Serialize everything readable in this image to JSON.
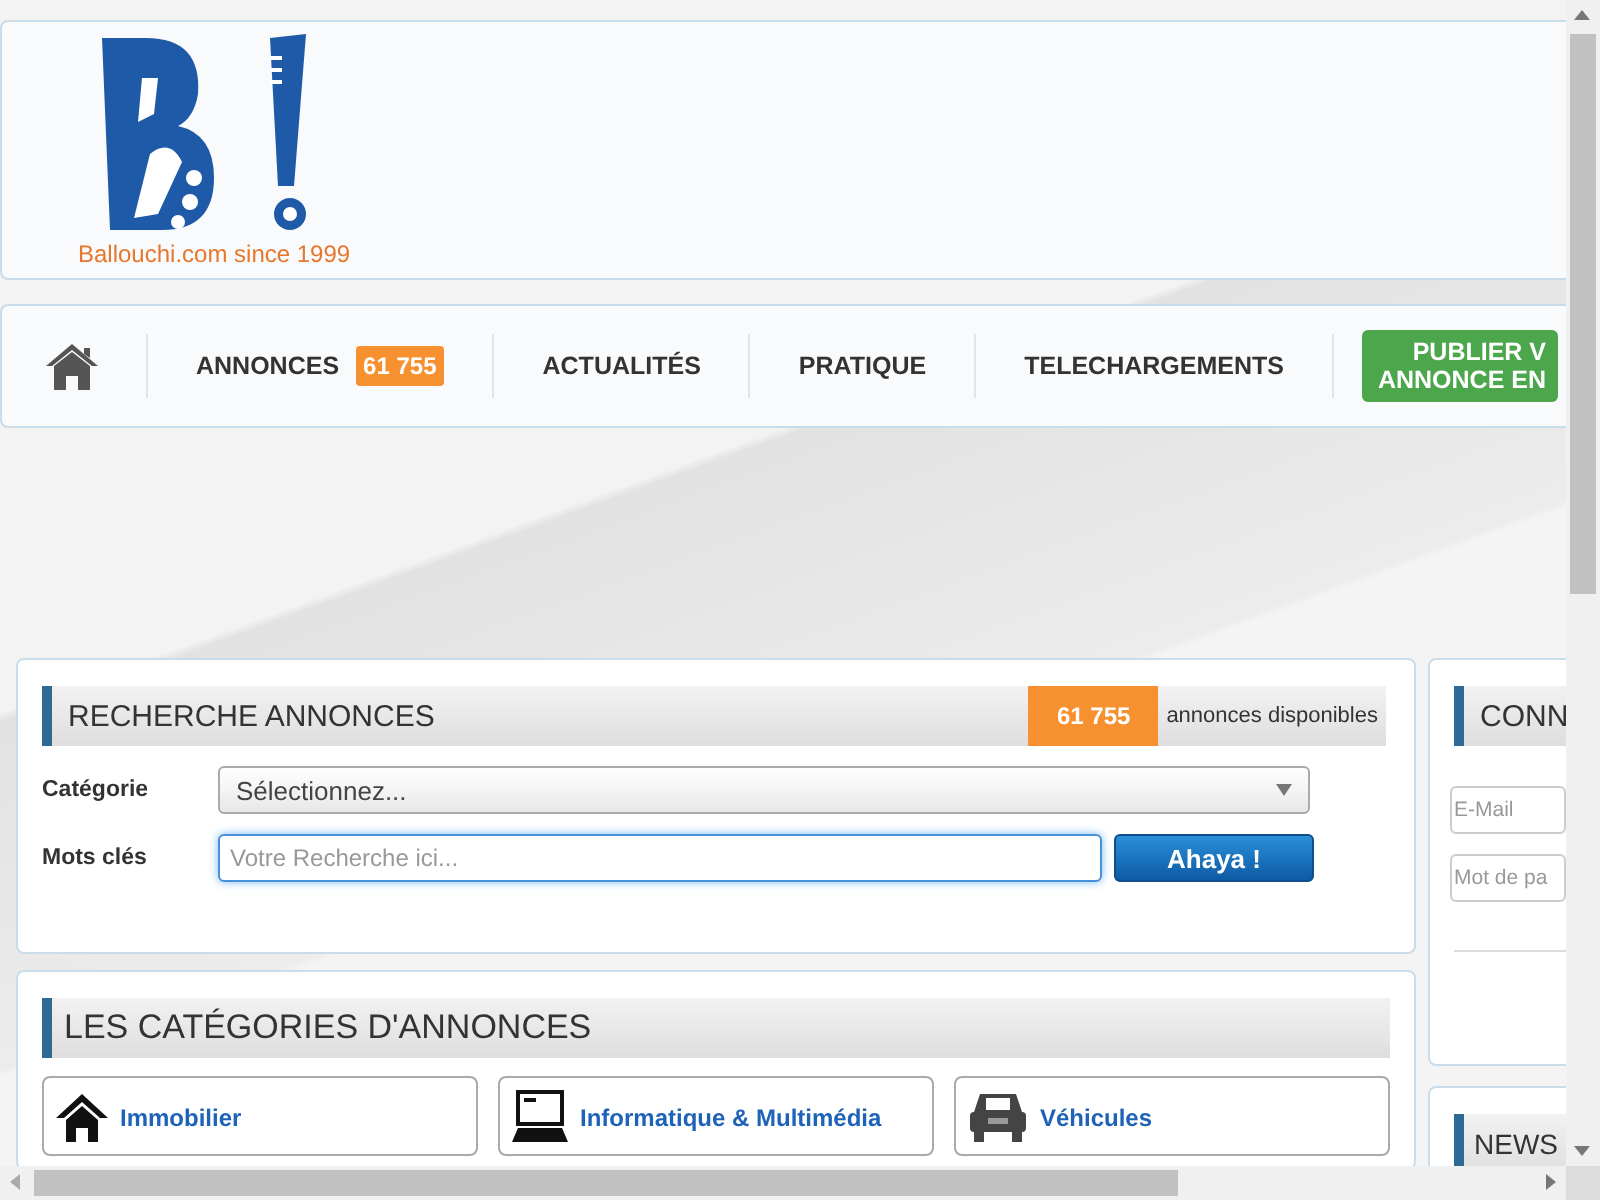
{
  "header": {
    "slogan": "Ballouchi.com since 1999"
  },
  "nav": {
    "items": [
      {
        "label": "ANNONCES",
        "badge": "61 755"
      },
      {
        "label": "ACTUALITÉS"
      },
      {
        "label": "PRATIQUE"
      },
      {
        "label": "TELECHARGEMENTS"
      }
    ],
    "publish_button": [
      "PUBLIER V",
      "ANNONCE EN"
    ]
  },
  "search": {
    "title": "RECHERCHE ANNONCES",
    "count": "61 755",
    "count_label": "annonces disponibles",
    "category_label": "Catégorie",
    "category_value": "Sélectionnez...",
    "keywords_label": "Mots clés",
    "keywords_placeholder": "Votre Recherche ici...",
    "submit": "Ahaya !"
  },
  "login": {
    "title": "CONN",
    "email_placeholder": "E-Mail",
    "password_placeholder": "Mot de pa"
  },
  "categories": {
    "title": "LES CATÉGORIES D'ANNONCES",
    "items": [
      {
        "label": "Immobilier"
      },
      {
        "label": "Informatique & Multimédia"
      },
      {
        "label": "Véhicules"
      }
    ]
  },
  "news": {
    "title": "NEWS"
  }
}
